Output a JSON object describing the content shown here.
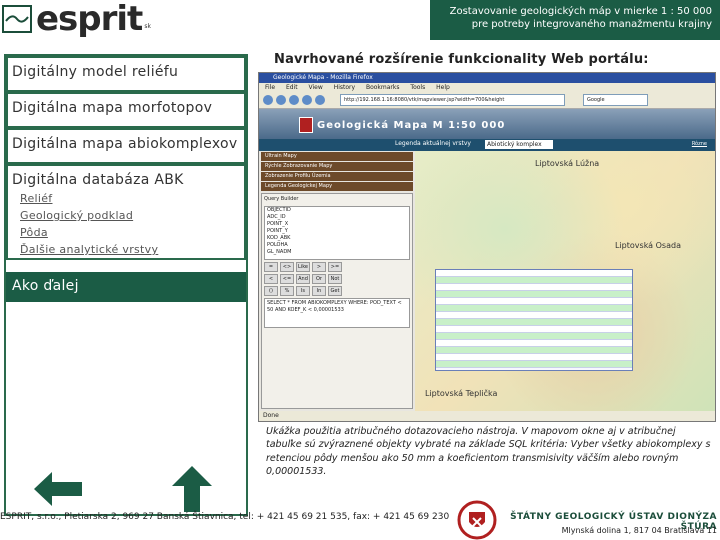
{
  "header": {
    "logo_text": "esprit",
    "logo_sub": "sk",
    "line1": "Zostavovanie geologických máp v mierke 1 : 50 000",
    "line2": "pre potreby integrovaného manažmentu krajiny"
  },
  "sidebar": {
    "items": [
      {
        "label": "Digitálny model reliéfu"
      },
      {
        "label": "Digitálna mapa morfotopov"
      },
      {
        "label": "Digitálna mapa abiokomplexov"
      },
      {
        "label": "Digitálna databáza ABK"
      }
    ],
    "sublinks": [
      "Reliéf",
      "Geologický podklad",
      "Pôda",
      "Ďalšie analytické vrstvy"
    ],
    "ako_dalej": "Ako ďalej"
  },
  "proposal_title": "Navrhované rozšírenie funkcionality Web portálu:",
  "browser": {
    "title": "Geologické Mapa - Mozilla Firefox",
    "menu": [
      "File",
      "Edit",
      "View",
      "History",
      "Bookmarks",
      "Tools",
      "Help"
    ],
    "url": "http://192.168.1.16:8080/vtk/mapviewer.jsp?width=700&height",
    "search": "Google",
    "status": "Done",
    "app_title": "Geologická Mapa  M 1:50 000",
    "legend_label": "Legenda aktuálnej vrstvy",
    "legend_select": "Abiotický komplex",
    "rozne": "Rôzne",
    "panel_items": [
      "Ultrain Mapy",
      "Rýchle Zobrazovanie Mapy",
      "Zobrazenie Profilu Územia",
      "Legenda Geologickej Mapy"
    ],
    "sql_header": "Query Builder",
    "sql_fields": [
      "OBJECTID",
      "ADC_ID",
      "POINT_X",
      "POINT_Y",
      "KOD_ABK",
      "POLOHA",
      "GL_NADM"
    ],
    "sql_buttons": [
      "=",
      "<>",
      "Like",
      ">",
      ">=",
      "<",
      "<=",
      "And",
      "Or",
      "Not",
      "()",
      "%",
      "Is",
      "In",
      "Get"
    ],
    "sql_text": "SELECT * FROM ABIOKOMPLEXY WHERE: POD_TEXT < 50 AND KOEF_K < 0,00001533",
    "map_labels": [
      "Liptovská Lúžna",
      "Liptovská Osada",
      "Liptovská Teplička"
    ]
  },
  "caption": "Ukážka použitia atribučného dotazovacieho nástroja. V mapovom okne aj v atribučnej tabuľke sú zvýraznené objekty vybraté na základe SQL kritéria: Vyber všetky abiokomplexy s retenciou pôdy menšou ako 50 mm a koeficientom transmisivity väčším alebo rovným 0,00001533.",
  "footer": {
    "address": "ESPRIT, s.r.o., Pletiarska 2, 969 27 Banská Štiavnica, tel: + 421 45 69 21 535, fax: + 421 45 69 230",
    "sgu_name": "ŠTÁTNY GEOLOGICKÝ ÚSTAV DIONÝZA ŠTÚRA",
    "sgu_address": "Mlynská dolina 1, 817 04 Bratislava 11"
  }
}
